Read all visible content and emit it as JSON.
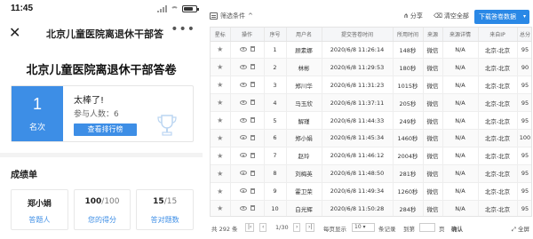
{
  "phone": {
    "status": {
      "time": "11:45"
    },
    "nav": {
      "close": "✕",
      "title": "北京儿童医院离退休干部答",
      "more": "•••"
    },
    "survey_title": "北京儿童医院离退休干部答卷",
    "rank": {
      "number": "1",
      "label": "名次",
      "congrats": "太棒了!",
      "participants": "参与人数：6",
      "ranking_button": "查看排行榜"
    },
    "scorecard": {
      "title": "成绩单",
      "cards": [
        {
          "value": "郑小娟",
          "value_muted": "",
          "label": "答题人"
        },
        {
          "value": "100",
          "value_muted": "/100",
          "label": "您的得分"
        },
        {
          "value": "15",
          "value_muted": "/15",
          "label": "答对题数"
        }
      ]
    }
  },
  "panel": {
    "toolbar": {
      "filter_label": "筛选条件",
      "share_label": "分享",
      "clear_label": "清空全部",
      "download_label": "下载答卷数据"
    },
    "table": {
      "headers": [
        "星标",
        "操作",
        "序号",
        "用户名",
        "提交答卷时间",
        "所用时间",
        "来源",
        "来源详情",
        "来自IP",
        "总分"
      ],
      "rows": [
        [
          "",
          "",
          "1",
          "顾素娜",
          "2020/6/8 11:26:14",
          "148秒",
          "微信",
          "N/A",
          "北京-北京",
          "95"
        ],
        [
          "",
          "",
          "2",
          "林彬",
          "2020/6/8 11:29:53",
          "180秒",
          "微信",
          "N/A",
          "北京-北京",
          "90"
        ],
        [
          "",
          "",
          "3",
          "郑川华",
          "2020/6/8 11:31:23",
          "1015秒",
          "微信",
          "N/A",
          "北京-北京",
          "95"
        ],
        [
          "",
          "",
          "4",
          "马玉欣",
          "2020/6/8 11:37:11",
          "205秒",
          "微信",
          "N/A",
          "北京-北京",
          "95"
        ],
        [
          "",
          "",
          "5",
          "解瑾",
          "2020/6/8 11:44:33",
          "249秒",
          "微信",
          "N/A",
          "北京-北京",
          "95"
        ],
        [
          "",
          "",
          "6",
          "郑小娟",
          "2020/6/8 11:45:34",
          "1460秒",
          "微信",
          "N/A",
          "北京-北京",
          "100"
        ],
        [
          "",
          "",
          "7",
          "赵玲",
          "2020/6/8 11:46:12",
          "2004秒",
          "微信",
          "N/A",
          "北京-北京",
          "95"
        ],
        [
          "",
          "",
          "8",
          "刘梅英",
          "2020/6/8 11:48:50",
          "281秒",
          "微信",
          "N/A",
          "北京-北京",
          "95"
        ],
        [
          "",
          "",
          "9",
          "霍卫荣",
          "2020/6/8 11:49:34",
          "1260秒",
          "微信",
          "N/A",
          "北京-北京",
          "95"
        ],
        [
          "",
          "",
          "10",
          "白光辉",
          "2020/6/8 11:50:28",
          "284秒",
          "微信",
          "N/A",
          "北京-北京",
          "95"
        ]
      ]
    },
    "pager": {
      "total": "共 292 条",
      "page": "1/30",
      "per_page_label": "每页显示",
      "per_page": "10",
      "per_page_unit": "条记录",
      "goto_label": "到第",
      "page_unit": "页",
      "confirm": "确认",
      "fullscreen": "全屏"
    }
  }
}
